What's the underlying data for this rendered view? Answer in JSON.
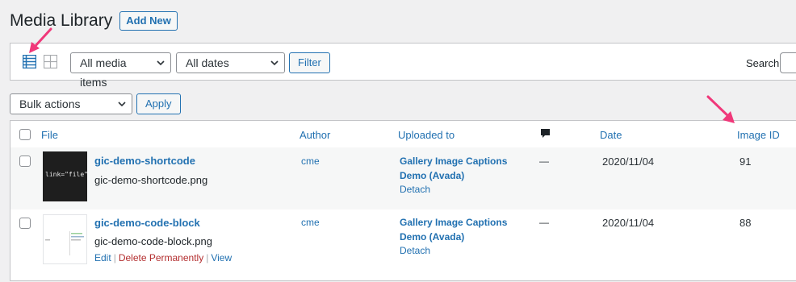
{
  "header": {
    "title": "Media Library",
    "add_new_label": "Add New"
  },
  "filters": {
    "media_type": "All media items",
    "dates": "All dates",
    "filter_label": "Filter",
    "search_label": "Search"
  },
  "bulk": {
    "action": "Bulk actions",
    "apply_label": "Apply"
  },
  "table": {
    "columns": {
      "file": "File",
      "author": "Author",
      "uploaded_to": "Uploaded to",
      "date": "Date",
      "image_id": "Image ID"
    },
    "rows": [
      {
        "thumb_text": "link=\"file\"",
        "title": "gic-demo-shortcode",
        "filename": "gic-demo-shortcode.png",
        "author": "cme",
        "uploaded_line1": "Gallery Image Captions",
        "uploaded_line2": "Demo (Avada)",
        "detach": "Detach",
        "comments": "—",
        "date": "2020/11/04",
        "image_id": "91"
      },
      {
        "title": "gic-demo-code-block",
        "filename": "gic-demo-code-block.png",
        "author": "cme",
        "uploaded_line1": "Gallery Image Captions",
        "uploaded_line2": "Demo (Avada)",
        "detach": "Detach",
        "comments": "—",
        "date": "2020/11/04",
        "image_id": "88",
        "actions": {
          "edit": "Edit",
          "delete": "Delete Permanently",
          "view": "View",
          "separator": "|"
        }
      }
    ]
  },
  "icons": {
    "list_view": "list-view-icon",
    "grid_view": "grid-view-icon",
    "comments": "comment-bubble-icon"
  },
  "colors": {
    "link": "#2271b1",
    "delete": "#b32d2e",
    "annotation_arrow": "#f0387a",
    "background": "#f0f0f1"
  }
}
